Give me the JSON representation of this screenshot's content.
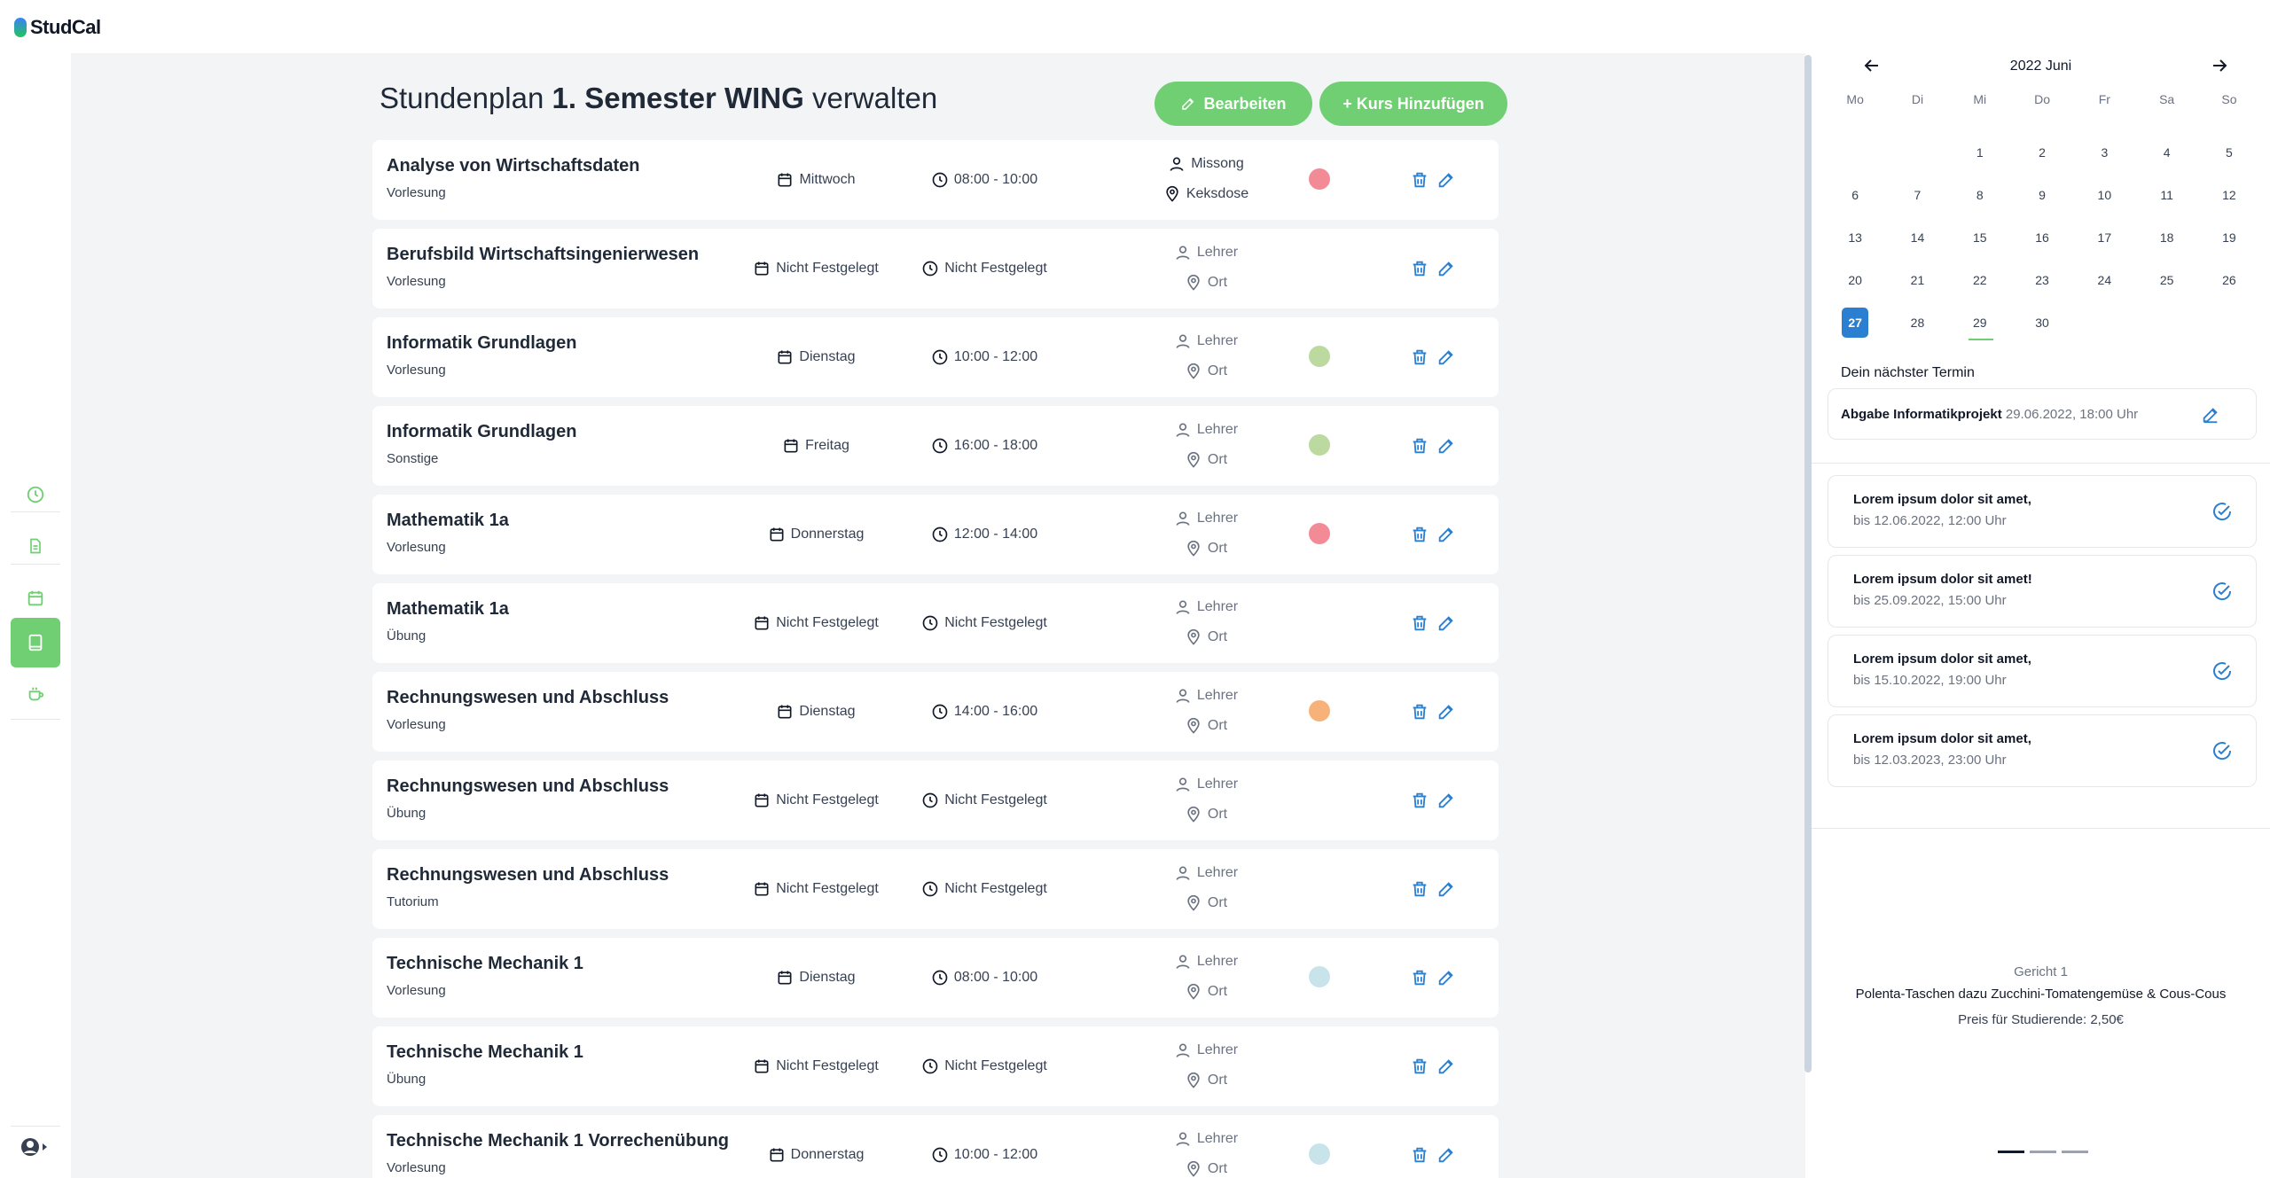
{
  "app": {
    "name": "StudCal"
  },
  "main": {
    "title_prefix": "Stundenplan",
    "title_bold": "1. Semester WING",
    "title_suffix": "verwalten",
    "edit_button": "Bearbeiten",
    "add_button": "+ Kurs Hinzufügen"
  },
  "courses": [
    {
      "name": "Analyse von Wirtschaftsdaten",
      "type": "Vorlesung",
      "day": "Mittwoch",
      "time": "08:00 - 10:00",
      "teacher": "Missong",
      "place": "Keksdose",
      "assigned": true,
      "color": "#f28b95"
    },
    {
      "name": "Berufsbild Wirtschaftsingenierwesen",
      "type": "Vorlesung",
      "day": "Nicht Festgelegt",
      "time": "Nicht Festgelegt",
      "teacher": "Lehrer",
      "place": "Ort",
      "assigned": false,
      "color": ""
    },
    {
      "name": "Informatik Grundlagen",
      "type": "Vorlesung",
      "day": "Dienstag",
      "time": "10:00 - 12:00",
      "teacher": "Lehrer",
      "place": "Ort",
      "assigned": false,
      "color": "#bcd9a0"
    },
    {
      "name": "Informatik Grundlagen",
      "type": "Sonstige",
      "day": "Freitag",
      "time": "16:00 - 18:00",
      "teacher": "Lehrer",
      "place": "Ort",
      "assigned": false,
      "color": "#bcd9a0"
    },
    {
      "name": "Mathematik 1a",
      "type": "Vorlesung",
      "day": "Donnerstag",
      "time": "12:00 - 14:00",
      "teacher": "Lehrer",
      "place": "Ort",
      "assigned": false,
      "color": "#f28b95"
    },
    {
      "name": "Mathematik 1a",
      "type": "Übung",
      "day": "Nicht Festgelegt",
      "time": "Nicht Festgelegt",
      "teacher": "Lehrer",
      "place": "Ort",
      "assigned": false,
      "color": ""
    },
    {
      "name": "Rechnungswesen und Abschluss",
      "type": "Vorlesung",
      "day": "Dienstag",
      "time": "14:00 - 16:00",
      "teacher": "Lehrer",
      "place": "Ort",
      "assigned": false,
      "color": "#f7b27a"
    },
    {
      "name": "Rechnungswesen und Abschluss",
      "type": "Übung",
      "day": "Nicht Festgelegt",
      "time": "Nicht Festgelegt",
      "teacher": "Lehrer",
      "place": "Ort",
      "assigned": false,
      "color": ""
    },
    {
      "name": "Rechnungswesen und Abschluss",
      "type": "Tutorium",
      "day": "Nicht Festgelegt",
      "time": "Nicht Festgelegt",
      "teacher": "Lehrer",
      "place": "Ort",
      "assigned": false,
      "color": ""
    },
    {
      "name": "Technische Mechanik 1",
      "type": "Vorlesung",
      "day": "Dienstag",
      "time": "08:00 - 10:00",
      "teacher": "Lehrer",
      "place": "Ort",
      "assigned": false,
      "color": "#c8e3ea"
    },
    {
      "name": "Technische Mechanik 1",
      "type": "Übung",
      "day": "Nicht Festgelegt",
      "time": "Nicht Festgelegt",
      "teacher": "Lehrer",
      "place": "Ort",
      "assigned": false,
      "color": ""
    },
    {
      "name": "Technische Mechanik 1 Vorrechenübung",
      "type": "Vorlesung",
      "day": "Donnerstag",
      "time": "10:00 - 12:00",
      "teacher": "Lehrer",
      "place": "Ort",
      "assigned": false,
      "color": "#c8e3ea"
    }
  ],
  "calendar": {
    "month_label": "2022 Juni",
    "weekdays": [
      "Mo",
      "Di",
      "Mi",
      "Do",
      "Fr",
      "Sa",
      "So"
    ],
    "leading_blanks": 2,
    "days": 30,
    "today": 27,
    "marked": 29
  },
  "next_event": {
    "label": "Dein nächster Termin",
    "title": "Abgabe Informatikprojekt",
    "when": "29.06.2022, 18:00 Uhr"
  },
  "todos": [
    {
      "title": "Lorem ipsum dolor sit amet,",
      "due": "bis 12.06.2022, 12:00 Uhr"
    },
    {
      "title": "Lorem ipsum dolor sit amet!",
      "due": "bis 25.09.2022, 15:00 Uhr"
    },
    {
      "title": "Lorem ipsum dolor sit amet,",
      "due": "bis 15.10.2022, 19:00 Uhr"
    },
    {
      "title": "Lorem ipsum dolor sit amet,",
      "due": "bis 12.03.2023, 23:00 Uhr"
    }
  ],
  "meal": {
    "label": "Gericht 1",
    "dish": "Polenta-Taschen dazu Zucchini-Tomatengemüse & Cous-Cous",
    "price": "Preis für Studierende: 2,50€"
  },
  "colors": {
    "accent": "#6fcf72",
    "today": "#2b7fd0",
    "icon_blue": "#2b7fd0"
  }
}
